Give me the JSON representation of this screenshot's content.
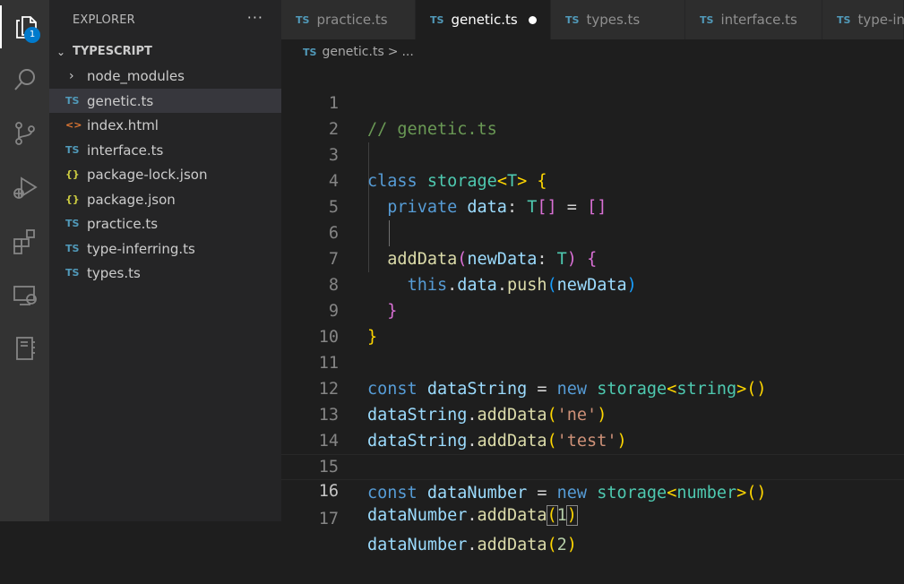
{
  "activity_bar": {
    "explorer_badge": "1",
    "items": [
      "files-icon",
      "search-icon",
      "source-control-icon",
      "run-debug-icon",
      "extensions-icon",
      "remote-explorer-icon",
      "notebook-icon"
    ]
  },
  "sidebar": {
    "title": "EXPLORER",
    "more": "···",
    "section_title": "TYPESCRIPT",
    "items": [
      {
        "label": "node_modules",
        "icon": ">",
        "kind": "folder"
      },
      {
        "label": "genetic.ts",
        "icon": "TS",
        "kind": "ts"
      },
      {
        "label": "index.html",
        "icon": "<>",
        "kind": "html"
      },
      {
        "label": "interface.ts",
        "icon": "TS",
        "kind": "ts"
      },
      {
        "label": "package-lock.json",
        "icon": "{}",
        "kind": "json"
      },
      {
        "label": "package.json",
        "icon": "{}",
        "kind": "json"
      },
      {
        "label": "practice.ts",
        "icon": "TS",
        "kind": "ts"
      },
      {
        "label": "type-inferring.ts",
        "icon": "TS",
        "kind": "ts"
      },
      {
        "label": "types.ts",
        "icon": "TS",
        "kind": "ts"
      }
    ]
  },
  "tabs": [
    {
      "icon": "TS",
      "label": "practice.ts"
    },
    {
      "icon": "TS",
      "label": "genetic.ts"
    },
    {
      "icon": "TS",
      "label": "types.ts"
    },
    {
      "icon": "TS",
      "label": "interface.ts"
    },
    {
      "icon": "TS",
      "label": "type-in"
    }
  ],
  "breadcrumb": {
    "icon": "TS",
    "file": "genetic.ts",
    "separator": ">",
    "more": "..."
  },
  "editor": {
    "line_numbers": [
      "1",
      "2",
      "3",
      "4",
      "5",
      "6",
      "7",
      "8",
      "9",
      "10",
      "11",
      "12",
      "13",
      "14",
      "15",
      "16",
      "17"
    ],
    "current_line": "16",
    "code": {
      "l1": "// genetic.ts",
      "l3": [
        "class",
        "storage",
        "<",
        "T",
        ">",
        "{"
      ],
      "l4": [
        "private",
        "data",
        ":",
        "T",
        "[]",
        "=",
        "[]"
      ],
      "l6": [
        "addData",
        "(",
        "newData",
        ":",
        "T",
        ")",
        "{"
      ],
      "l7": [
        "this",
        ".",
        "data",
        ".",
        "push",
        "(",
        "newData",
        ")"
      ],
      "l8": "}",
      "l9": "}",
      "l11": [
        "const",
        "dataString",
        "=",
        "new",
        "storage",
        "<",
        "string",
        ">",
        "()"
      ],
      "l12": [
        "dataString",
        ".",
        "addData",
        "(",
        "'ne'",
        ")"
      ],
      "l13": [
        "dataString",
        ".",
        "addData",
        "(",
        "'test'",
        ")"
      ],
      "l15": [
        "const",
        "dataNumber",
        "=",
        "new",
        "storage",
        "<",
        "number",
        ">",
        "()"
      ],
      "l16": [
        "dataNumber",
        ".",
        "addData",
        "(",
        "1",
        ")"
      ],
      "l17": [
        "dataNumber",
        ".",
        "addData",
        "(",
        "2",
        ")"
      ]
    }
  },
  "colors": {
    "keyword": "#569cd6",
    "class": "#4ec9b0",
    "function": "#dcdcaa",
    "variable": "#9cdcfe",
    "string": "#ce9178",
    "number": "#b5cea8",
    "comment": "#6a9955",
    "bracket_1": "#ffd700",
    "bracket_2": "#da70d6",
    "bracket_3": "#179fff",
    "accent": "#007acc"
  }
}
